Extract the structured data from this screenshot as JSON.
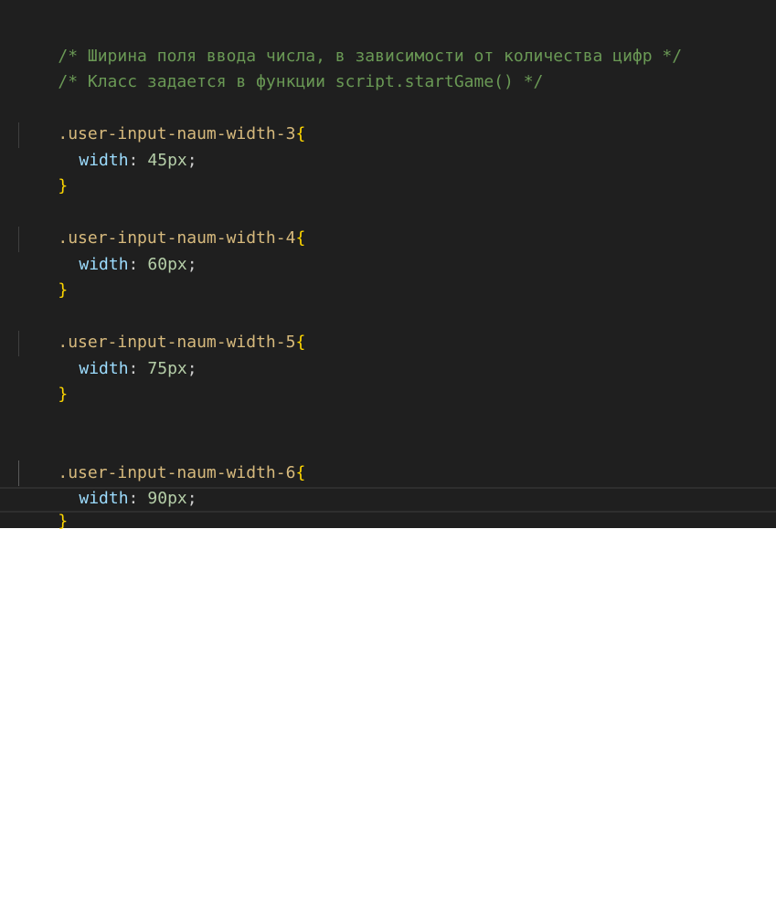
{
  "editor": {
    "comment_lines": [
      "/* Ширина поля ввода числа, в зависимости от количества цифр */",
      "/* Класс задается в функции script.startGame() */"
    ],
    "rules": [
      {
        "selector": ".user-input-naum-width-3",
        "open_brace": "{",
        "property": "width",
        "colon": ":",
        "value": "45px",
        "semicolon": ";",
        "close_brace": "}"
      },
      {
        "selector": ".user-input-naum-width-4",
        "open_brace": "{",
        "property": "width",
        "colon": ":",
        "value": "60px",
        "semicolon": ";",
        "close_brace": "}"
      },
      {
        "selector": ".user-input-naum-width-5",
        "open_brace": "{",
        "property": "width",
        "colon": ":",
        "value": "75px",
        "semicolon": ";",
        "close_brace": "}"
      },
      {
        "selector": ".user-input-naum-width-6",
        "open_brace": "{",
        "property": "width",
        "colon": ":",
        "value": "90px",
        "semicolon": ";",
        "close_brace": "}"
      }
    ],
    "colors": {
      "background": "#1f1f1f",
      "comment": "#6a9955",
      "selector": "#d7ba7d",
      "brace": "#ffd700",
      "property": "#9cdcfe",
      "number": "#b5cea8",
      "punctuation": "#cccccc"
    }
  }
}
